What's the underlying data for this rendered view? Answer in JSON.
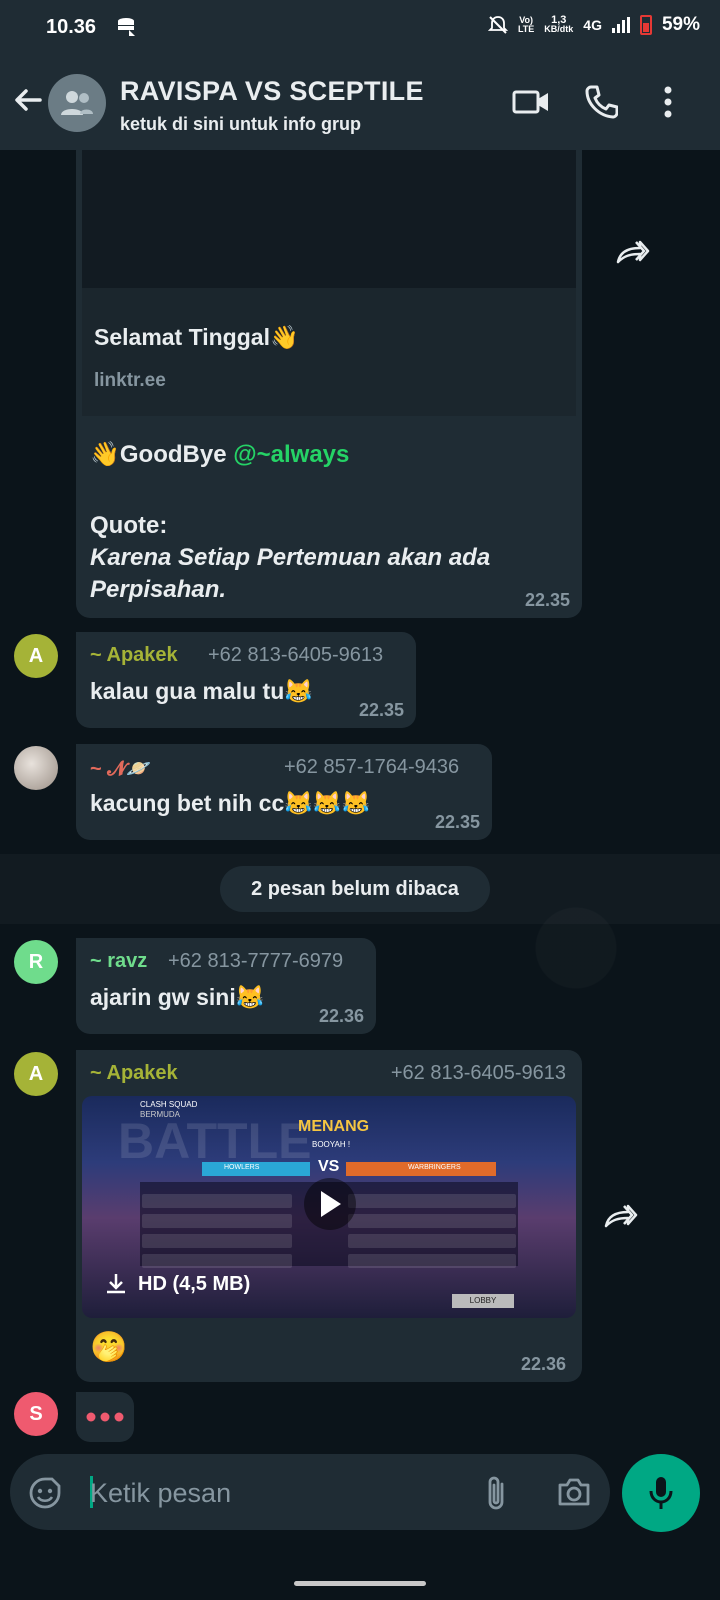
{
  "status_bar": {
    "time": "10.36",
    "net_speed_value": "1,3",
    "net_speed_unit": "KB/dtk",
    "volte_top": "Vo)",
    "volte_bottom": "LTE",
    "network": "4G",
    "battery": "59%"
  },
  "header": {
    "title": "RAVISPA VS SCEPTILE",
    "subtitle": "ketuk di sini untuk info grup"
  },
  "link_preview_message": {
    "preview_title": "Selamat Tinggal👋",
    "preview_domain": "linktr.ee",
    "line1_text": "👋GoodBye ",
    "line1_mention": "@~always",
    "quote_label": "Quote:",
    "quote_line1": "Karena Setiap Pertemuan akan ada",
    "quote_line2": "Perpisahan.",
    "time": "22.35"
  },
  "messages": [
    {
      "avatar_letter": "A",
      "sender": "~ Apakek",
      "phone": "+62 813-6405-9613",
      "text": "kalau gua malu tu😹",
      "time": "22.35",
      "sender_color": "#a5b337"
    },
    {
      "avatar_letter": "",
      "sender": "~ 𝓝🪐",
      "phone": "+62 857-1764-9436",
      "text": "kacung bet nih cc😹😹😹",
      "time": "22.35",
      "sender_color": "#e26a5b"
    },
    {
      "avatar_letter": "R",
      "sender": "~ ravz",
      "phone": "+62 813-7777-6979",
      "text": "ajarin gw sini😹",
      "time": "22.36",
      "sender_color": "#53bdeb"
    }
  ],
  "unread_divider": "2 pesan belum dibaca",
  "video_message": {
    "avatar_letter": "A",
    "sender": "~ Apakek",
    "phone": "+62 813-6405-9613",
    "game_mode": "CLASH SQUAD",
    "game_sub": "BERMUDA",
    "result": "MENANG",
    "result_sub": "BOOYAH !",
    "team_left": "HOWLERS",
    "team_right": "WARBRINGERS",
    "vs": "VS",
    "hd_label": "HD (4,5 MB)",
    "lobby": "LOBBY",
    "caption": "🤭",
    "time": "22.36"
  },
  "typing": {
    "avatar_letter": "S"
  },
  "composer": {
    "placeholder": "Ketik pesan"
  },
  "colors": {
    "bubble": "#1f2c34",
    "accent": "#00a884",
    "background": "#0b141a"
  },
  "icons": [
    "back-arrow-icon",
    "group-icon",
    "video-call-icon",
    "phone-icon",
    "more-vert-icon",
    "forward-icon",
    "play-icon",
    "download-icon",
    "emoji-icon",
    "attach-icon",
    "camera-icon",
    "mic-icon"
  ]
}
